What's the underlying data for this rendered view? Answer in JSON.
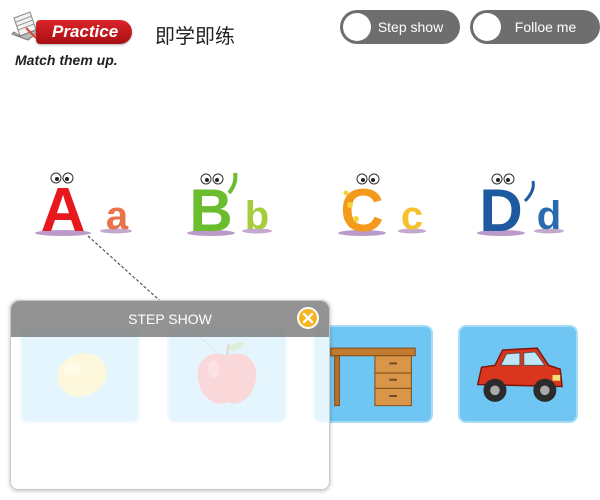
{
  "header": {
    "badge_label": "Practice",
    "chinese_title": "即学即练",
    "instruction": "Match them up."
  },
  "toggles": {
    "step_show_label": "Step show",
    "follow_me_label": "Folloe me"
  },
  "letters": [
    {
      "upper": "A",
      "lower": "a",
      "color": "#e8191c"
    },
    {
      "upper": "B",
      "lower": "b",
      "color": "#6cbd2e"
    },
    {
      "upper": "C",
      "lower": "c",
      "color": "#f39a1c"
    },
    {
      "upper": "D",
      "lower": "d",
      "color": "#1f5aa0"
    }
  ],
  "cards": [
    {
      "icon": "lemon-icon"
    },
    {
      "icon": "apple-icon"
    },
    {
      "icon": "desk-icon"
    },
    {
      "icon": "car-icon"
    }
  ],
  "popup": {
    "title": "STEP SHOW",
    "close_icon": "close-icon",
    "close_color": "#f4b51e"
  },
  "colors": {
    "badge": "#c4161c",
    "toggle": "#6e6e6e",
    "card": "#70c6f2"
  }
}
